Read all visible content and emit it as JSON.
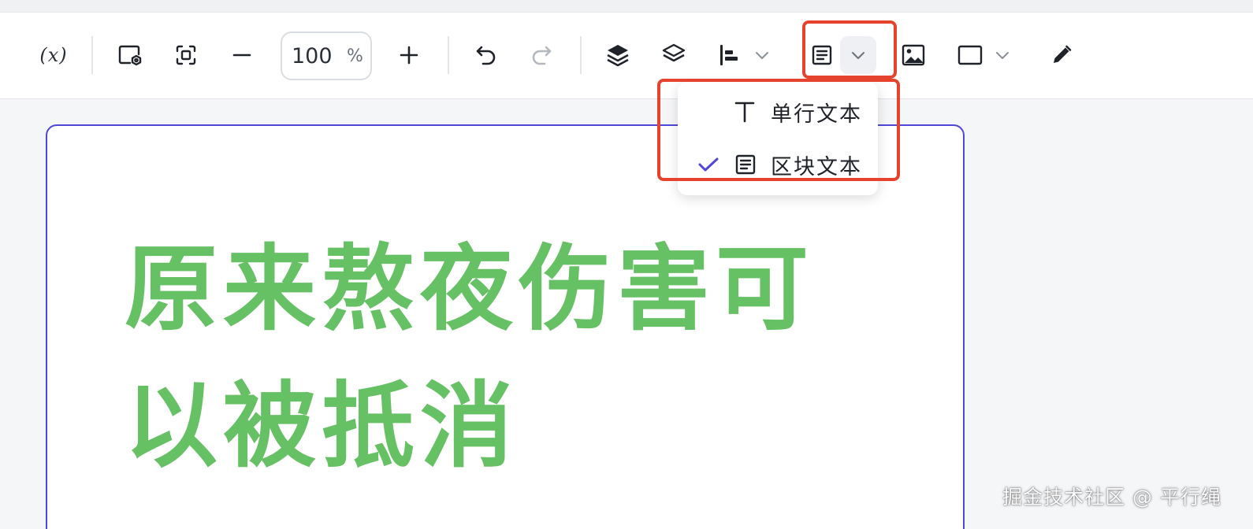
{
  "toolbar": {
    "variable_label": "(x)",
    "zoom": {
      "value": "100",
      "unit": "%"
    },
    "icons": {
      "variable": "variable-icon",
      "preview": "preview-screen-icon",
      "fit": "fit-screen-icon",
      "zoom_out": "minus-icon",
      "zoom_in": "plus-icon",
      "undo": "undo-icon",
      "redo": "redo-icon",
      "layer_up": "layer-up-icon",
      "layers": "layers-icon",
      "align": "align-left-icon",
      "text": "text-block-icon",
      "image": "image-icon",
      "shape": "rectangle-icon",
      "pen": "pen-icon"
    }
  },
  "text_menu": {
    "items": [
      {
        "label": "单行文本",
        "icon": "single-line-text-icon",
        "checked": false
      },
      {
        "label": "区块文本",
        "icon": "text-block-icon",
        "checked": true
      }
    ]
  },
  "canvas": {
    "headline": "原来熬夜伤害可以被抵消",
    "text_color": "#66c165",
    "selection_color": "#4f47d8"
  },
  "highlight_color": "#e5432d",
  "watermark": "掘金技术社区 @ 平行绳"
}
